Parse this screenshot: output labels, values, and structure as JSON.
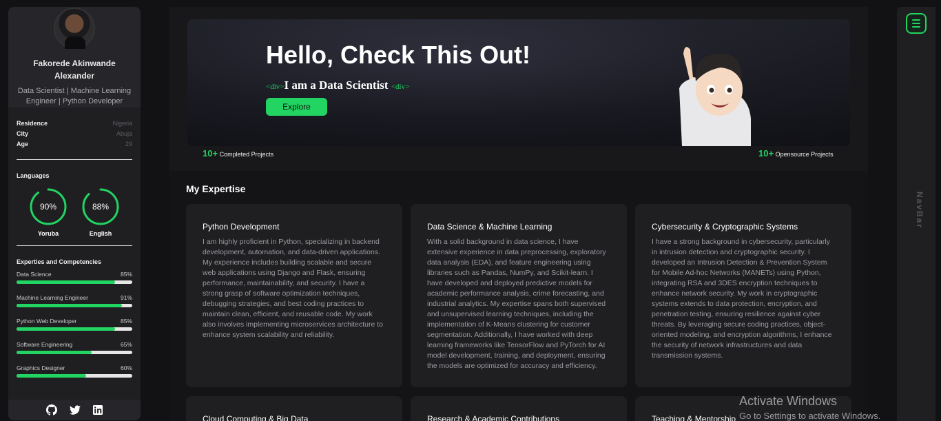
{
  "profile": {
    "name": "Fakorede Akinwande Alexander",
    "role": "Data Scientist | Machine Learning Engineer | Python Developer",
    "info": [
      {
        "key": "Residence",
        "value": "Nigeria"
      },
      {
        "key": "City",
        "value": "Abuja"
      },
      {
        "key": "Age",
        "value": "29"
      }
    ]
  },
  "languages": {
    "title": "Languages",
    "items": [
      {
        "name": "Yoruba",
        "percent": "90%",
        "value": 0.9
      },
      {
        "name": "English",
        "percent": "88%",
        "value": 0.88
      }
    ]
  },
  "skills": {
    "title": "Experties and Competencies",
    "items": [
      {
        "name": "Data Science",
        "percent": "85%",
        "value": 0.85
      },
      {
        "name": "Machine Learning Engineer",
        "percent": "91%",
        "value": 0.91
      },
      {
        "name": "Python Web Developer",
        "percent": "85%",
        "value": 0.85
      },
      {
        "name": "Software Engineering",
        "percent": "65%",
        "value": 0.65
      },
      {
        "name": "Graphics Designer",
        "percent": "60%",
        "value": 0.6
      }
    ]
  },
  "social": [
    "github-icon",
    "twitter-icon",
    "linkedin-icon"
  ],
  "hero": {
    "title": "Hello, Check This Out!",
    "tag_open": "<div>",
    "tag_text": "I am a Data Scientist",
    "tag_close": "<div>",
    "explore": "Explore"
  },
  "stats": [
    {
      "count": "10+",
      "label": "Completed Projects"
    },
    {
      "count": "10+",
      "label": "Opensource Projects"
    }
  ],
  "expertise": {
    "title": "My Expertise",
    "cards": [
      {
        "title": "Python Development",
        "text": "I am highly proficient in Python, specializing in backend development, automation, and data-driven applications. My experience includes building scalable and secure web applications using Django and Flask, ensuring performance, maintainability, and security. I have a strong grasp of software optimization techniques, debugging strategies, and best coding practices to maintain clean, efficient, and reusable code. My work also involves implementing microservices architecture to enhance system scalability and reliability."
      },
      {
        "title": "Data Science & Machine Learning",
        "text": "With a solid background in data science, I have extensive experience in data preprocessing, exploratory data analysis (EDA), and feature engineering using libraries such as Pandas, NumPy, and Scikit-learn. I have developed and deployed predictive models for academic performance analysis, crime forecasting, and industrial analytics. My expertise spans both supervised and unsupervised learning techniques, including the implementation of K-Means clustering for customer segmentation. Additionally, I have worked with deep learning frameworks like TensorFlow and PyTorch for AI model development, training, and deployment, ensuring the models are optimized for accuracy and efficiency."
      },
      {
        "title": "Cybersecurity & Cryptographic Systems",
        "text": "I have a strong background in cybersecurity, particularly in intrusion detection and cryptographic security. I developed an Intrusion Detection & Prevention System for Mobile Ad-hoc Networks (MANETs) using Python, integrating RSA and 3DES encryption techniques to enhance network security. My work in cryptographic systems extends to data protection, encryption, and penetration testing, ensuring resilience against cyber threats. By leveraging secure coding practices, object-oriented modeling, and encryption algorithms, I enhance the security of network infrastructures and data transmission systems."
      }
    ],
    "more": [
      "Cloud Computing & Big Data",
      "Research & Academic Contributions",
      "Teaching & Mentorship"
    ]
  },
  "nav": {
    "vertical_label": "NavBar"
  },
  "watermark": {
    "line1": "Activate Windows",
    "line2": "Go to Settings to activate Windows."
  },
  "colors": {
    "accent": "#22d462",
    "panel": "#1f1f22",
    "background": "#121214"
  }
}
